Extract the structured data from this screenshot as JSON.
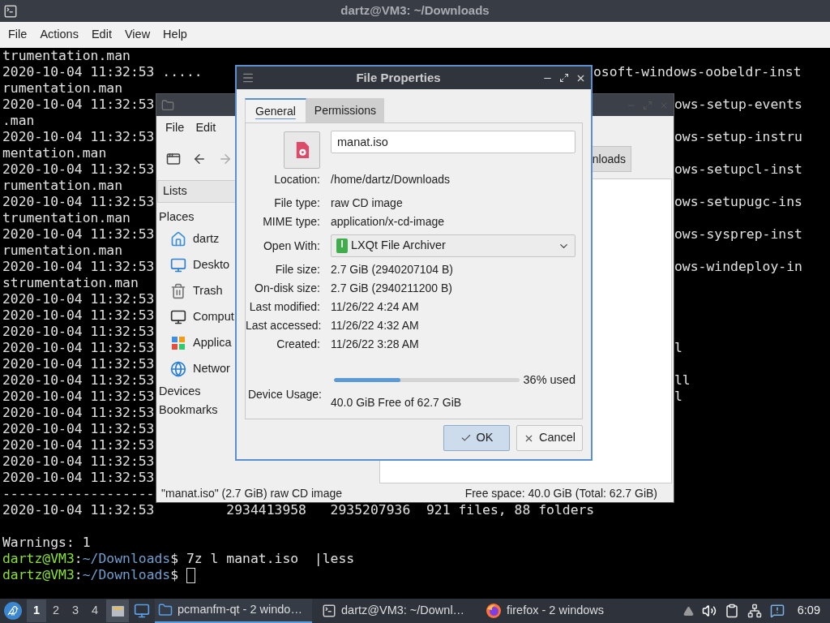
{
  "terminal": {
    "title": "dartz@VM3: ~/Downloads",
    "menu": [
      "File",
      "Actions",
      "Edit",
      "View",
      "Help"
    ],
    "lines": [
      {
        "kind": "output",
        "text": "trumentation.man"
      },
      {
        "kind": "output",
        "text": "2020-10-04 11:32:53 .....",
        "tail": "osoft-windows-oobeldr-inst"
      },
      {
        "kind": "output",
        "text": "rumentation.man"
      },
      {
        "kind": "output",
        "text": "2020-10-04 11:32:53",
        "tail": "ows-setup-events"
      },
      {
        "kind": "output",
        "text": ".man"
      },
      {
        "kind": "output",
        "text": "2020-10-04 11:32:53",
        "tail": "ows-setup-instru"
      },
      {
        "kind": "output",
        "text": "mentation.man"
      },
      {
        "kind": "output",
        "text": "2020-10-04 11:32:53",
        "tail": "ows-setupcl-inst"
      },
      {
        "kind": "output",
        "text": "rumentation.man"
      },
      {
        "kind": "output",
        "text": "2020-10-04 11:32:53",
        "tail": "ows-setupugc-ins"
      },
      {
        "kind": "output",
        "text": "trumentation.man"
      },
      {
        "kind": "output",
        "text": "2020-10-04 11:32:53",
        "tail": "ows-sysprep-inst"
      },
      {
        "kind": "output",
        "text": "rumentation.man"
      },
      {
        "kind": "output",
        "text": "2020-10-04 11:32:53",
        "tail": "ows-windeploy-in"
      },
      {
        "kind": "output",
        "text": "strumentation.man"
      },
      {
        "kind": "output",
        "text": "2020-10-04 11:32:53"
      },
      {
        "kind": "output",
        "text": "2020-10-04 11:32:53"
      },
      {
        "kind": "output",
        "text": "2020-10-04 11:32:53"
      },
      {
        "kind": "output",
        "text": "2020-10-04 11:32:53",
        "tail": "l"
      },
      {
        "kind": "output",
        "text": "2020-10-04 11:32:53"
      },
      {
        "kind": "output",
        "text": "2020-10-04 11:32:53",
        "tail": "ll"
      },
      {
        "kind": "output",
        "text": "2020-10-04 11:32:53",
        "tail": "l"
      },
      {
        "kind": "output",
        "text": "2020-10-04 11:32:53"
      },
      {
        "kind": "output",
        "text": "2020-10-04 11:32:53"
      },
      {
        "kind": "output",
        "text": "2020-10-04 11:32:53"
      },
      {
        "kind": "output",
        "text": "2020-10-04 11:32:53"
      },
      {
        "kind": "output",
        "text": "2020-10-04 11:32:53"
      },
      {
        "kind": "output",
        "text": "-------------------"
      },
      {
        "kind": "output",
        "text": "2020-10-04 11:32:53         2934413958   2935207936  921 files, 88 folders"
      },
      {
        "kind": "blank"
      },
      {
        "kind": "output",
        "text": "Warnings: 1"
      },
      {
        "kind": "prompt",
        "segments": [
          {
            "kind": "user",
            "text": "dartz@VM3"
          },
          {
            "kind": "plain",
            "text": ":"
          },
          {
            "kind": "path",
            "text": "~/Downloads"
          },
          {
            "kind": "plain",
            "text": "$ 7z l manat.iso  |less"
          }
        ]
      },
      {
        "kind": "prompt",
        "cursor": true,
        "segments": [
          {
            "kind": "user",
            "text": "dartz@VM3"
          },
          {
            "kind": "plain",
            "text": ":"
          },
          {
            "kind": "path",
            "text": "~/Downloads"
          },
          {
            "kind": "plain",
            "text": "$ "
          }
        ]
      }
    ]
  },
  "file_manager": {
    "menu": [
      "File",
      "Edit"
    ],
    "path_button": "nloads",
    "lists": "Lists",
    "places_heading": "Places",
    "places": [
      {
        "label": "dartz",
        "kind": "home"
      },
      {
        "label": "Deskto",
        "kind": "desktop"
      },
      {
        "label": "Trash",
        "kind": "trash"
      },
      {
        "label": "Comput",
        "kind": "computer"
      },
      {
        "label": "Applica",
        "kind": "applications"
      },
      {
        "label": "Networ",
        "kind": "network"
      }
    ],
    "headings": [
      "Devices",
      "Bookmarks"
    ],
    "status_left": "\"manat.iso\" (2.7 GiB) raw CD image",
    "status_right": "Free space: 40.0 GiB (Total: 62.7 GiB)"
  },
  "dialog": {
    "title": "File Properties",
    "tabs": [
      {
        "label": "General",
        "selected": true
      },
      {
        "label": "Permissions",
        "selected": false
      }
    ],
    "name": "manat.iso",
    "rows": [
      {
        "kind": "text",
        "label": "Location:",
        "value": "/home/dartz/Downloads"
      },
      {
        "kind": "text",
        "label": "File type:",
        "value": "raw CD image"
      },
      {
        "kind": "text",
        "label": "MIME type:",
        "value": "application/x-cd-image"
      },
      {
        "kind": "combo",
        "label": "Open With:",
        "value": "LXQt File Archiver"
      },
      {
        "kind": "text",
        "label": "File size:",
        "value": "2.7 GiB (2940207104 B)"
      },
      {
        "kind": "text",
        "label": "On-disk size:",
        "value": "2.7 GiB (2940211200 B)"
      },
      {
        "kind": "text",
        "label": "Last modified:",
        "value": "11/26/22 4:24 AM"
      },
      {
        "kind": "text",
        "label": "Last accessed:",
        "value": "11/26/22 4:32 AM"
      },
      {
        "kind": "text",
        "label": "Created:",
        "value": "11/26/22 3:28 AM"
      }
    ],
    "device_usage": {
      "label": "Device Usage:",
      "level": 0.36,
      "reading": "36% used",
      "free": "40.0 GiB Free of 62.7 GiB"
    },
    "buttons": [
      {
        "kind": "ok",
        "label": "OK",
        "default": true
      },
      {
        "kind": "cancel",
        "label": "Cancel",
        "default": false
      }
    ]
  },
  "taskbar": {
    "desktops": [
      {
        "label": "1",
        "selected": true
      },
      {
        "label": "2",
        "selected": false
      },
      {
        "label": "3",
        "selected": false
      },
      {
        "label": "4",
        "selected": false
      }
    ],
    "tasks": [
      {
        "kind": "folder",
        "label": "pcmanfm-qt - 2 windo…",
        "selected": true
      },
      {
        "kind": "terminal",
        "label": "dartz@VM3: ~/Downl…",
        "selected": false
      },
      {
        "kind": "browser",
        "label": "firefox - 2 windows",
        "selected": false
      }
    ],
    "clock": "6:09"
  }
}
